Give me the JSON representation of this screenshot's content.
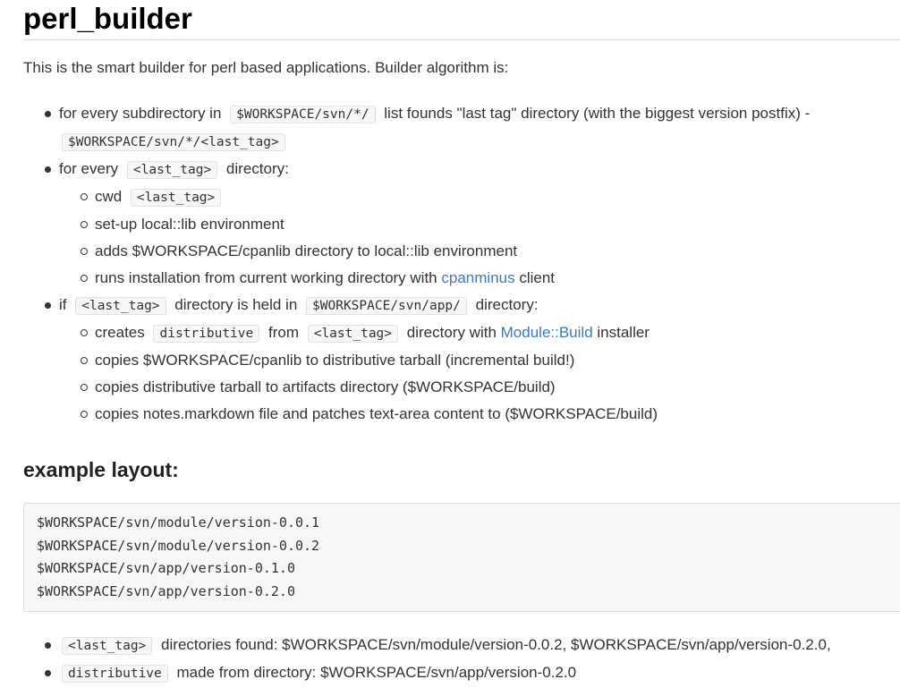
{
  "title": "perl_builder",
  "intro": "This is the smart builder for perl based applications. Builder algorithm is:",
  "steps": {
    "step1": {
      "text1": "for every subdirectory in",
      "code1": "$WORKSPACE/svn/*/",
      "text2": "list founds \"last tag\" directory (with the biggest version postfix) -",
      "code2": "$WORKSPACE/svn/*/<last_tag>"
    },
    "step2": {
      "text1": "for every",
      "code1": "<last_tag>",
      "text2": "directory:",
      "sub": {
        "cwd_text": "cwd",
        "cwd_code": "<last_tag>",
        "setup": "set-up local::lib environment",
        "adds": "adds $WORKSPACE/cpanlib directory to local::lib environment",
        "runs_text1": "runs installation from current working directory with",
        "runs_link": "cpanminus",
        "runs_text2": "client"
      }
    },
    "step3": {
      "text1": "if",
      "code1": "<last_tag>",
      "text2": "directory is held in",
      "code2": "$WORKSPACE/svn/app/",
      "text3": "directory:",
      "sub": {
        "creates_text1": "creates",
        "creates_code1": "distributive",
        "creates_text2": "from",
        "creates_code2": "<last_tag>",
        "creates_text3": "directory with",
        "creates_link": "Module::Build",
        "creates_text4": "installer",
        "copies_cpanlib": "copies $WORKSPACE/cpanlib to distributive tarball (incremental build!)",
        "copies_tarball": "copies distributive tarball to artifacts directory ($WORKSPACE/build)",
        "copies_notes": "copies notes.markdown file and patches text-area content to ($WORKSPACE/build)"
      }
    }
  },
  "example": {
    "heading": "example layout:",
    "lines": [
      "$WORKSPACE/svn/module/version-0.0.1",
      "$WORKSPACE/svn/module/version-0.0.2",
      "$WORKSPACE/svn/app/version-0.1.0",
      "$WORKSPACE/svn/app/version-0.2.0"
    ]
  },
  "results": {
    "item1_code": "<last_tag>",
    "item1_text": "directories found: $WORKSPACE/svn/module/version-0.0.2, $WORKSPACE/svn/app/version-0.2.0,",
    "item2_code": "distributive",
    "item2_text": "made from directory: $WORKSPACE/svn/app/version-0.2.0"
  }
}
